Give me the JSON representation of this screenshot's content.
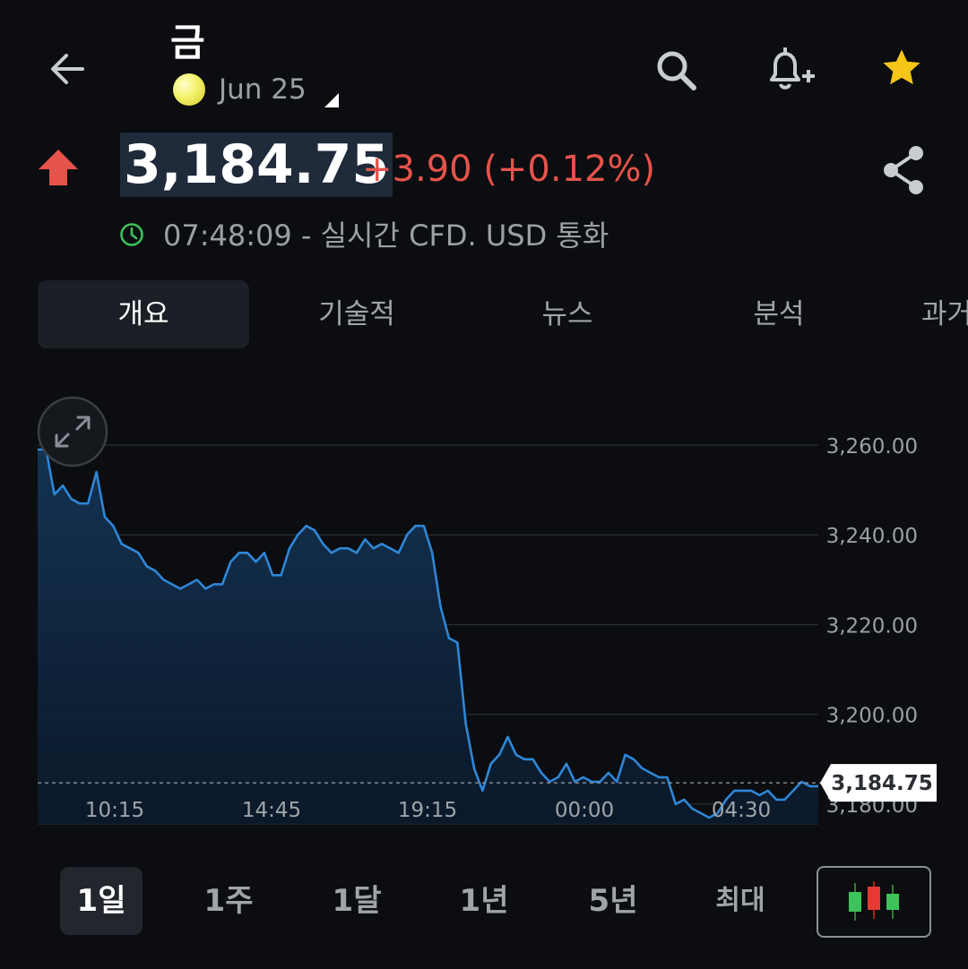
{
  "header": {
    "title": "금",
    "contract": "Jun 25",
    "price": "3,184.75",
    "change": "+3.90 (+0.12%)",
    "time_info": "07:48:09 - 실시간 CFD. USD 통화"
  },
  "tabs": [
    "개요",
    "기술적",
    "뉴스",
    "분석",
    "과거"
  ],
  "ranges": [
    "1일",
    "1주",
    "1달",
    "1년",
    "5년",
    "최대"
  ],
  "colors": {
    "background": "#0b0d10",
    "line": "#2f86d6",
    "up": "#e5534b",
    "star": "#f5c518",
    "clock": "#3cc35a"
  },
  "icons": [
    "back-arrow-icon",
    "search-icon",
    "bell-plus-icon",
    "star-icon",
    "up-arrow-icon",
    "share-icon",
    "clock-icon",
    "expand-icon",
    "candlestick-icon"
  ],
  "chart_data": {
    "type": "area",
    "y_ticks": [
      "3,260.00",
      "3,240.00",
      "3,220.00",
      "3,200.00",
      "3,180.00"
    ],
    "y_tick_values": [
      3260,
      3240,
      3220,
      3200,
      3180
    ],
    "ylim": [
      3175.6,
      3260
    ],
    "x_ticks": [
      "10:15",
      "14:45",
      "19:15",
      "00:00",
      "04:30"
    ],
    "last_price_label": "3,184.75",
    "last_value": 3184.75,
    "values": [
      3259,
      3259,
      3249,
      3251,
      3248,
      3247,
      3247,
      3254,
      3244,
      3242,
      3238,
      3237,
      3236,
      3233,
      3232,
      3230,
      3229,
      3228,
      3229,
      3230,
      3228,
      3229,
      3229,
      3234,
      3236,
      3236,
      3234,
      3236,
      3231,
      3231,
      3237,
      3240,
      3242,
      3241,
      3238,
      3236,
      3237,
      3237,
      3236,
      3239,
      3237,
      3238,
      3237,
      3236,
      3240,
      3242,
      3242,
      3236,
      3224,
      3217,
      3216,
      3198,
      3188,
      3183,
      3189,
      3191,
      3195,
      3191,
      3190,
      3190,
      3187,
      3185,
      3186,
      3189,
      3185,
      3186,
      3185,
      3185,
      3187,
      3185,
      3191,
      3190,
      3188,
      3187,
      3186,
      3186,
      3180,
      3181,
      3179,
      3178,
      3177,
      3178,
      3181,
      3183,
      3183,
      3183,
      3182,
      3183,
      3181,
      3181,
      3183,
      3185,
      3184,
      3184
    ]
  }
}
